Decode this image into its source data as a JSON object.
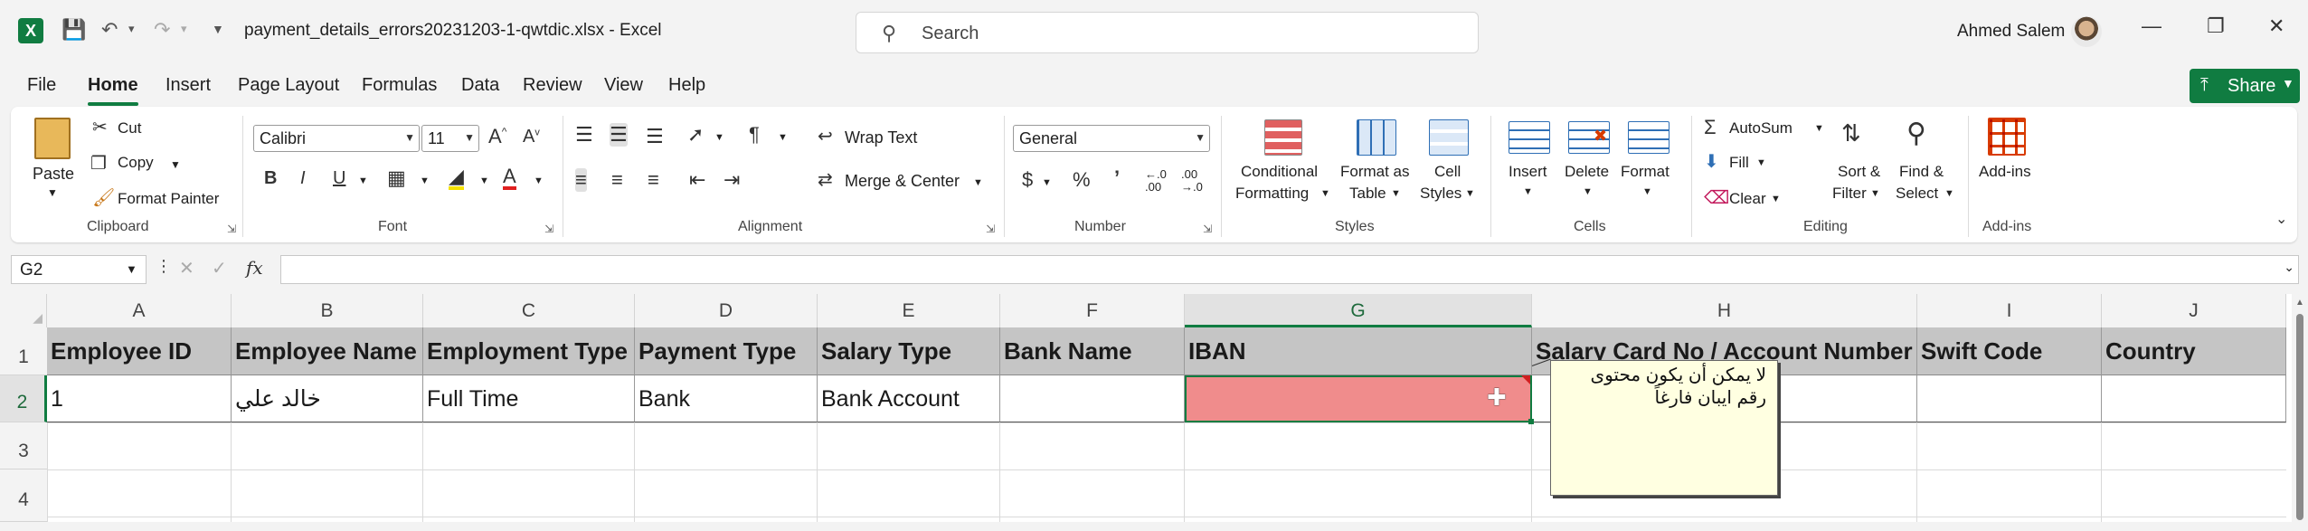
{
  "titlebar": {
    "filename": "payment_details_errors20231203-1-qwtdic.xlsx  -  Excel",
    "search_placeholder": "Search",
    "user_name": "Ahmed Salem"
  },
  "menu": {
    "file": "File",
    "home": "Home",
    "insert": "Insert",
    "page_layout": "Page Layout",
    "formulas": "Formulas",
    "data": "Data",
    "review": "Review",
    "view": "View",
    "help": "Help",
    "share": "Share"
  },
  "ribbon": {
    "clipboard": {
      "paste": "Paste",
      "cut": "Cut",
      "copy": "Copy",
      "format_painter": "Format Painter",
      "group": "Clipboard"
    },
    "font": {
      "name": "Calibri",
      "size": "11",
      "group": "Font"
    },
    "alignment": {
      "wrap_text": "Wrap Text",
      "merge_center": "Merge & Center",
      "group": "Alignment"
    },
    "number": {
      "format": "General",
      "group": "Number"
    },
    "styles": {
      "conditional_1": "Conditional",
      "conditional_2": "Formatting",
      "format_table_1": "Format as",
      "format_table_2": "Table",
      "cell_styles_1": "Cell",
      "cell_styles_2": "Styles",
      "group": "Styles"
    },
    "cells": {
      "insert": "Insert",
      "delete": "Delete",
      "format": "Format",
      "group": "Cells"
    },
    "editing": {
      "autosum": "AutoSum",
      "fill": "Fill",
      "clear": "Clear",
      "sort_1": "Sort &",
      "sort_2": "Filter",
      "find_1": "Find &",
      "find_2": "Select",
      "group": "Editing"
    },
    "addins": {
      "label": "Add-ins",
      "group": "Add-ins"
    }
  },
  "formula_bar": {
    "name_box": "G2",
    "fx": "fx",
    "value": ""
  },
  "grid": {
    "columns": [
      "A",
      "B",
      "C",
      "D",
      "E",
      "F",
      "G",
      "H",
      "I",
      "J"
    ],
    "rows": [
      "1",
      "2",
      "3",
      "4"
    ],
    "header_row": [
      "Employee ID",
      "Employee Name",
      "Employment Type",
      "Payment Type",
      "Salary Type",
      "Bank Name",
      "IBAN",
      "Salary Card No / Account Number",
      "Swift Code",
      "Country"
    ],
    "data_row": [
      "1",
      "خالد علي",
      "Full Time",
      "Bank",
      "Bank Account",
      "",
      "",
      "",
      "",
      ""
    ],
    "error_fill": "#f08c8c",
    "selected_cell": "G2"
  },
  "comment": {
    "line1": "لا يمكن أن يكون محتوى",
    "line2": "رقم ايبان فارغاً"
  }
}
